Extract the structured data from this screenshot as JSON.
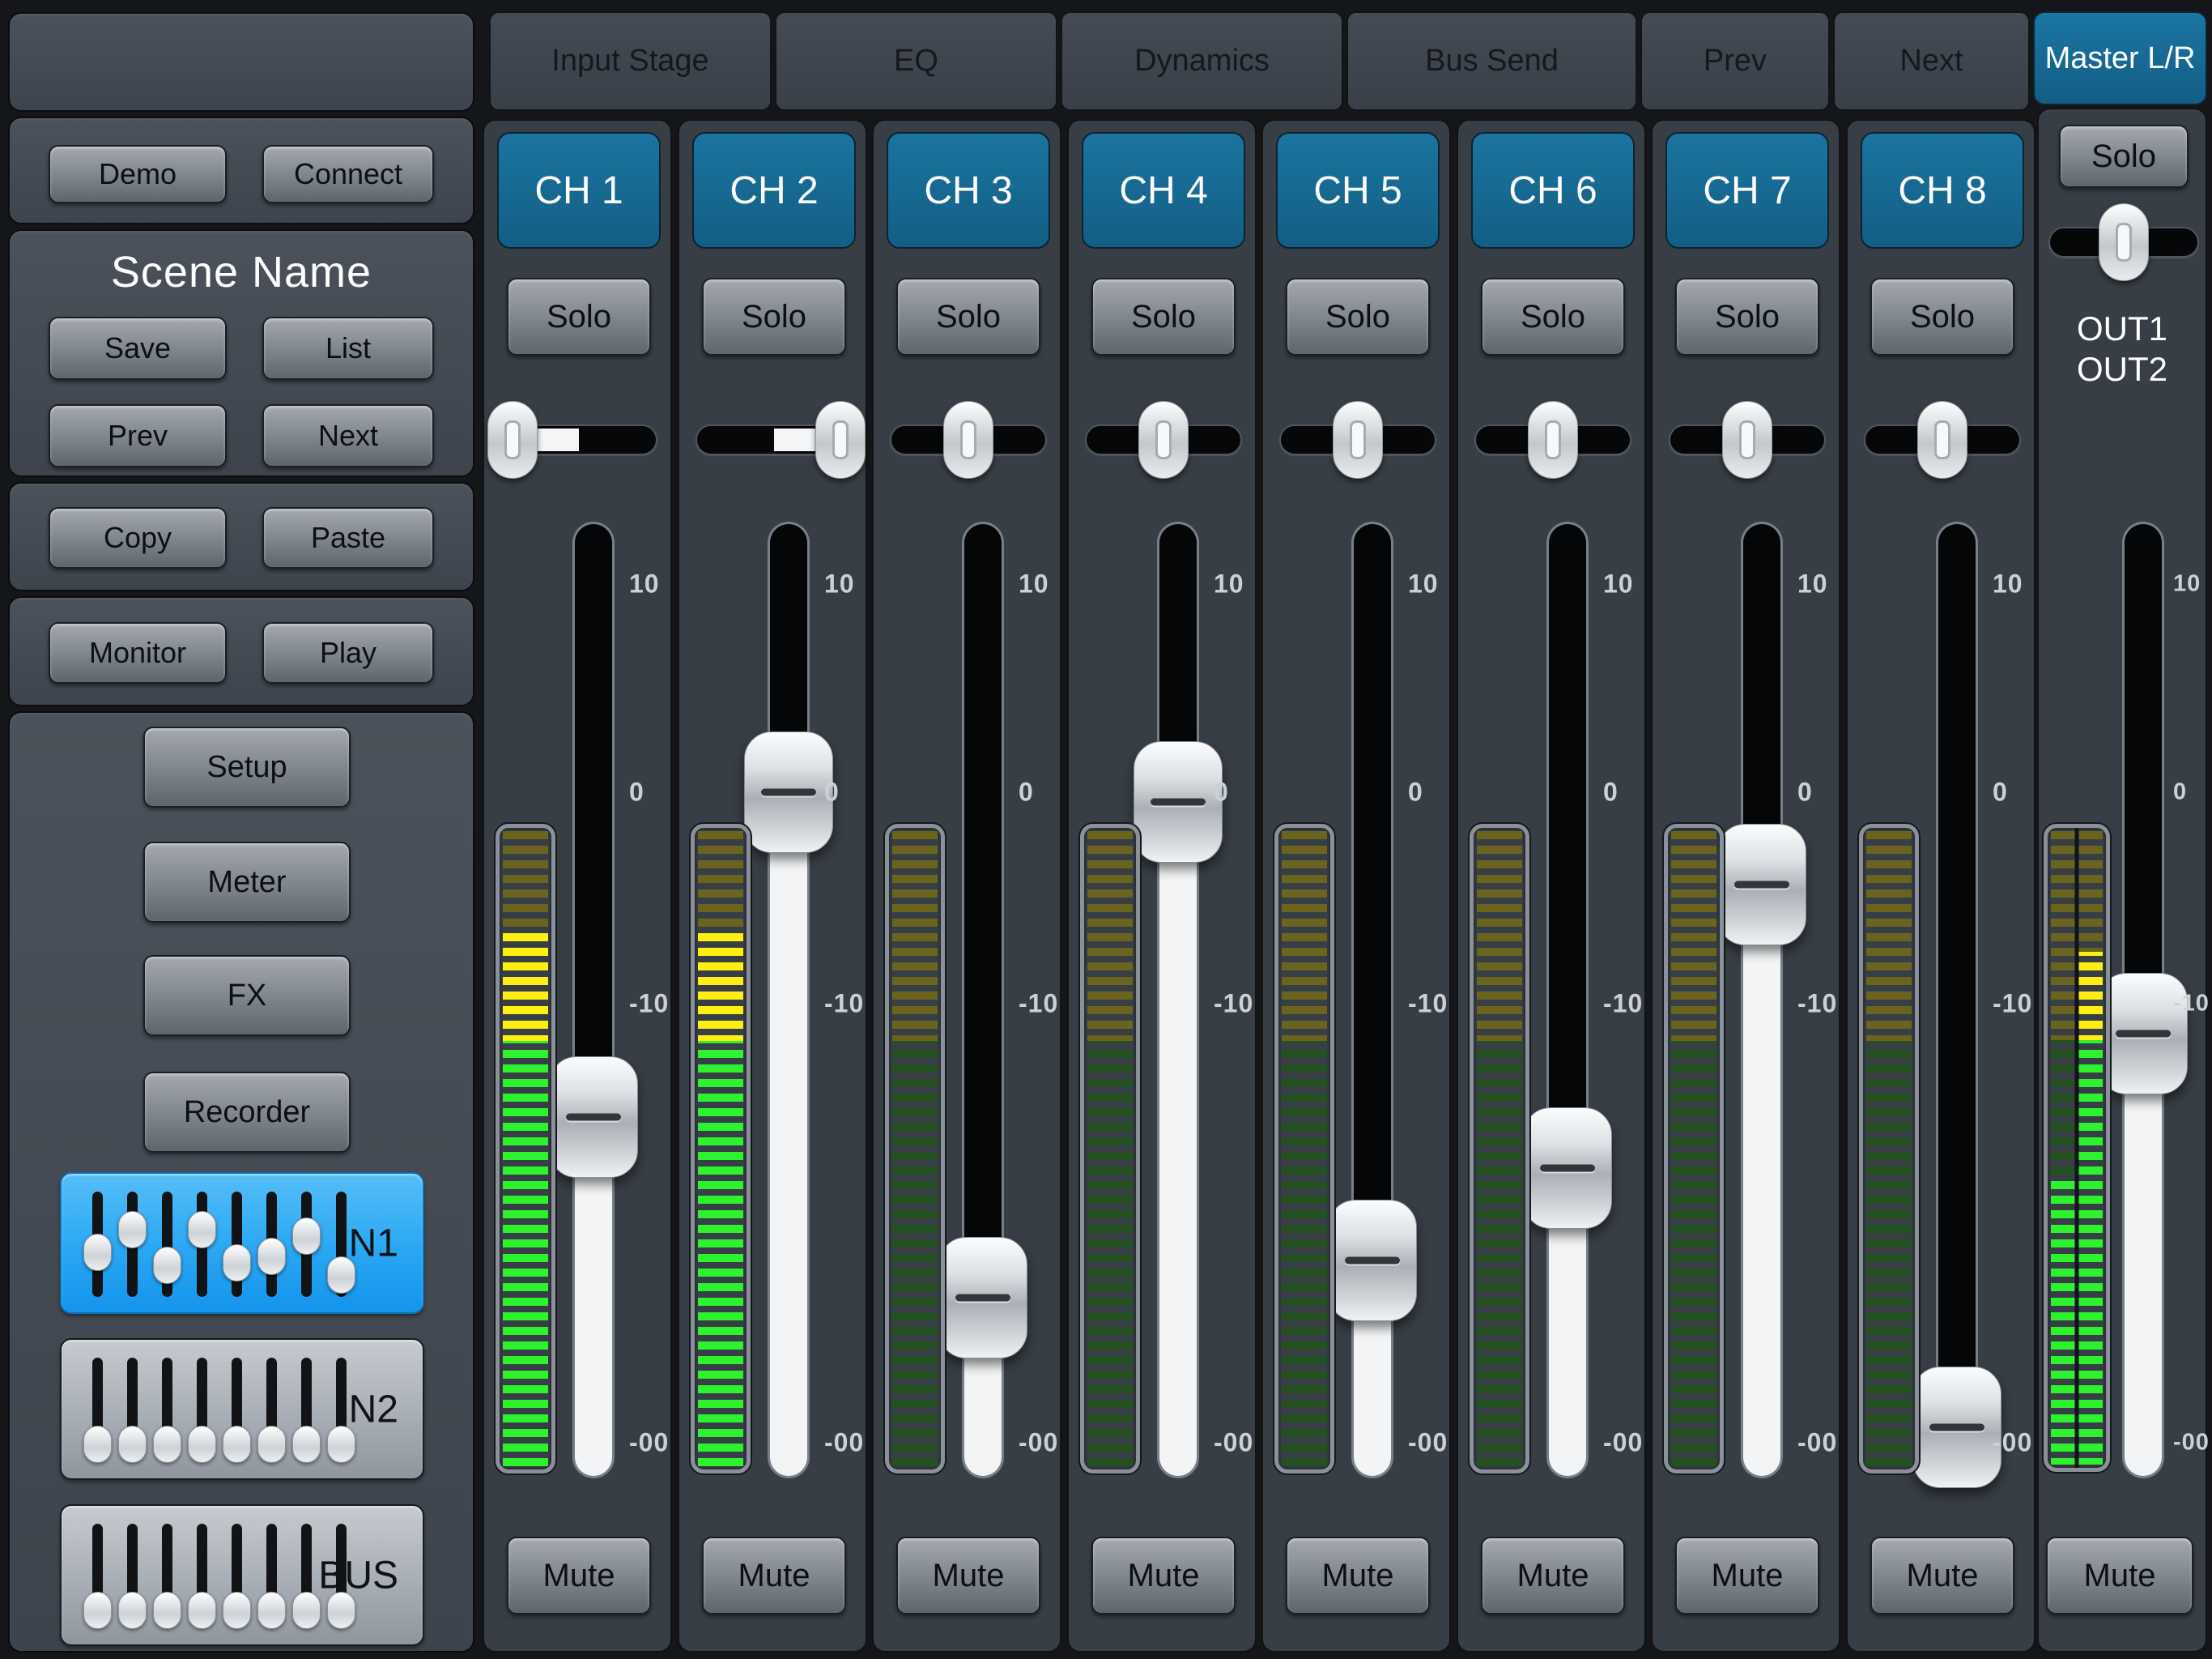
{
  "sidebar": {
    "demo": "Demo",
    "connect": "Connect",
    "scene_title": "Scene Name",
    "save": "Save",
    "list": "List",
    "prev": "Prev",
    "next": "Next",
    "copy": "Copy",
    "paste": "Paste",
    "monitor": "Monitor",
    "play": "Play",
    "menu": [
      "Setup",
      "Meter",
      "FX",
      "Recorder"
    ],
    "banks": [
      {
        "label": "IN1",
        "active": true,
        "fader_positions": [
          0.62,
          0.28,
          0.81,
          0.29,
          0.77,
          0.68,
          0.38,
          0.95
        ]
      },
      {
        "label": "IN2",
        "active": false,
        "fader_positions": [
          1,
          1,
          1,
          1,
          1,
          1,
          1,
          1
        ]
      },
      {
        "label": "BUS",
        "active": false,
        "fader_positions": [
          1,
          1,
          1,
          1,
          1,
          1,
          1,
          1
        ]
      }
    ]
  },
  "tabs": [
    "Input Stage",
    "EQ",
    "Dynamics",
    "Bus Send",
    "Prev",
    "Next"
  ],
  "master_tab": "Master L/R",
  "fader_scale": [
    {
      "label": "10",
      "pos": 0.063
    },
    {
      "label": "0",
      "pos": 0.282
    },
    {
      "label": "-10",
      "pos": 0.504
    },
    {
      "label": "-00",
      "pos": 0.965
    }
  ],
  "meter_config": {
    "yellow_zone_fraction": 0.33
  },
  "channels": [
    {
      "name": "CH 1",
      "solo": "Solo",
      "mute": "Mute",
      "pan": -1,
      "fader_pos": 0.623,
      "meter_lit": 0.84
    },
    {
      "name": "CH 2",
      "solo": "Solo",
      "mute": "Mute",
      "pan": 1,
      "fader_pos": 0.282,
      "meter_lit": 0.84
    },
    {
      "name": "CH 3",
      "solo": "Solo",
      "mute": "Mute",
      "pan": 0,
      "fader_pos": 0.813,
      "meter_lit": 0
    },
    {
      "name": "CH 4",
      "solo": "Solo",
      "mute": "Mute",
      "pan": 0,
      "fader_pos": 0.292,
      "meter_lit": 0
    },
    {
      "name": "CH 5",
      "solo": "Solo",
      "mute": "Mute",
      "pan": 0,
      "fader_pos": 0.774,
      "meter_lit": 0
    },
    {
      "name": "CH 6",
      "solo": "Solo",
      "mute": "Mute",
      "pan": 0,
      "fader_pos": 0.677,
      "meter_lit": 0
    },
    {
      "name": "CH 7",
      "solo": "Solo",
      "mute": "Mute",
      "pan": 0,
      "fader_pos": 0.379,
      "meter_lit": 0
    },
    {
      "name": "CH 8",
      "solo": "Solo",
      "mute": "Mute",
      "pan": 0,
      "fader_pos": 0.949,
      "meter_lit": 0
    }
  ],
  "master": {
    "solo": "Solo",
    "mute": "Mute",
    "pan": 0,
    "out_labels": [
      "OUT1",
      "OUT2"
    ],
    "fader_pos": 0.535,
    "meter_lit_left": 0.45,
    "meter_lit_right": 0.81
  },
  "colors": {
    "channel_teal": "#16698f",
    "bank_active_blue": "#2aa7f3",
    "meter_green_lit": "#2df22d",
    "meter_green_dim": "#24511f",
    "meter_yellow_lit": "#ffee12",
    "meter_yellow_dim": "#6a641f"
  }
}
